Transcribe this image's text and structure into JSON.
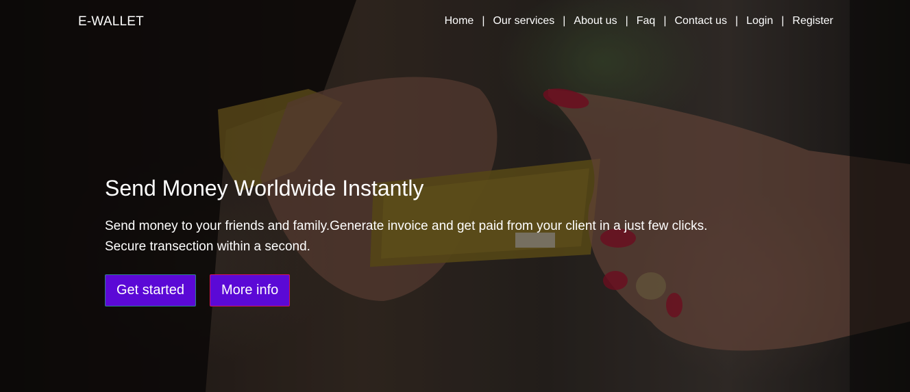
{
  "brand": {
    "name": "E-WALLET"
  },
  "nav": {
    "items": [
      {
        "label": "Home"
      },
      {
        "label": "Our services"
      },
      {
        "label": "About us"
      },
      {
        "label": "Faq"
      },
      {
        "label": "Contact us"
      },
      {
        "label": "Login"
      },
      {
        "label": "Register"
      }
    ],
    "separator": "|"
  },
  "hero": {
    "title": "Send Money Worldwide Instantly",
    "line1": "Send money to your friends and family.Generate invoice and get paid from your client in a just few clicks.",
    "line2": "Secure transection within a second.",
    "primary_button": "Get started",
    "secondary_button": "More info"
  },
  "theme": {
    "button_color": "#5b09d6",
    "text_color": "#ffffff"
  }
}
